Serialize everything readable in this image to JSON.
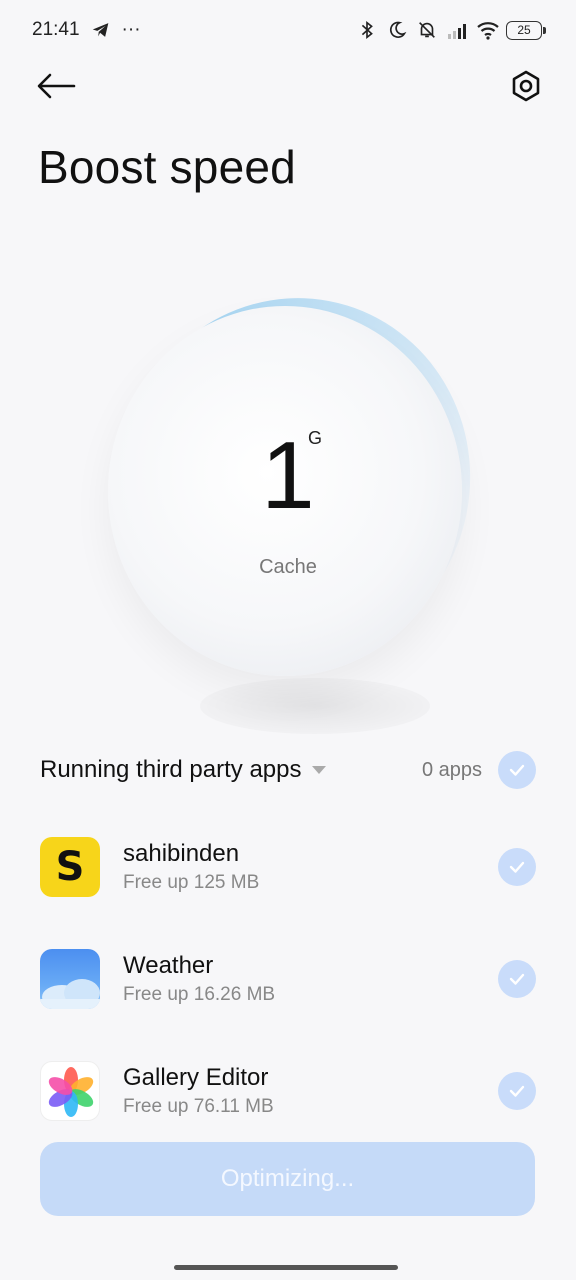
{
  "status_bar": {
    "time": "21:41",
    "dots": "···",
    "battery": "25",
    "icons": [
      "telegram-icon",
      "bluetooth-icon",
      "moon-icon",
      "mute-icon",
      "signal-icon",
      "wifi-icon",
      "battery-icon"
    ]
  },
  "header": {
    "back_icon": "back-arrow-icon",
    "settings_icon": "settings-icon",
    "title": "Boost speed"
  },
  "gauge": {
    "value": "1",
    "unit": "G",
    "label": "Cache"
  },
  "section": {
    "title": "Running third party apps",
    "count": "0 apps",
    "selected": true
  },
  "apps": [
    {
      "name": "sahibinden",
      "free_up": "Free up 125 MB",
      "icon": "sahibinden-icon",
      "icon_letter": "S",
      "selected": true
    },
    {
      "name": "Weather",
      "free_up": "Free up 16.26 MB",
      "icon": "weather-icon",
      "selected": true
    },
    {
      "name": "Gallery Editor",
      "free_up": "Free up 76.11 MB",
      "icon": "gallery-editor-icon",
      "selected": true
    }
  ],
  "action_button": {
    "label": "Optimizing..."
  },
  "colors": {
    "accent_light": "#c9dcfa",
    "button_bg": "#c5daf8",
    "background": "#f7f7f9"
  }
}
